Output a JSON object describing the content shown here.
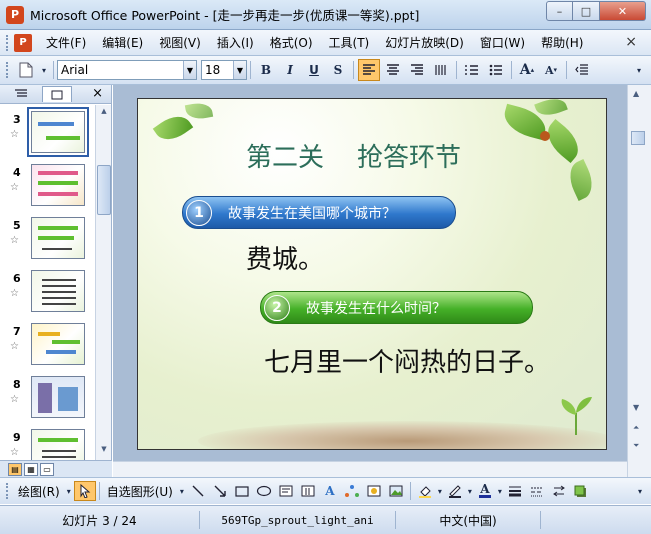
{
  "window": {
    "title": "Microsoft Office PowerPoint - [走一步再走一步(优质课一等奖).ppt]",
    "minimize": "–",
    "restore": "□",
    "close": "✕"
  },
  "menu": {
    "items": [
      "文件(F)",
      "编辑(E)",
      "视图(V)",
      "插入(I)",
      "格式(O)",
      "工具(T)",
      "幻灯片放映(D)",
      "窗口(W)",
      "帮助(H)"
    ],
    "close": "×"
  },
  "toolbar": {
    "font_name": "Arial",
    "font_size": "18",
    "bold": "B",
    "italic": "I",
    "underline": "U",
    "shadow": "S",
    "increase_font": "A",
    "decrease_font": "A"
  },
  "panel": {
    "close": "×",
    "slides": [
      {
        "num": "3"
      },
      {
        "num": "4"
      },
      {
        "num": "5"
      },
      {
        "num": "6"
      },
      {
        "num": "7"
      },
      {
        "num": "8"
      },
      {
        "num": "9"
      }
    ]
  },
  "slide": {
    "title": "第二关    抢答环节",
    "q1_num": "1",
    "q1_text": "故事发生在美国哪个城市？",
    "a1": "费城。",
    "q2_num": "2",
    "q2_text": "故事发生在什么时间？",
    "a2": "七月里一个闷热的日子。"
  },
  "drawbar": {
    "draw_label": "绘图(R)",
    "autoshape_label": "自选图形(U)",
    "font_color_letter": "A"
  },
  "status": {
    "slide_pos": "幻灯片 3 / 24",
    "design": "569TGp_sprout_light_ani",
    "language": "中文(中国)"
  },
  "colors": {
    "title_green": "#2c6e5a",
    "banner_blue": "#2f78cc",
    "banner_green": "#45b028"
  }
}
